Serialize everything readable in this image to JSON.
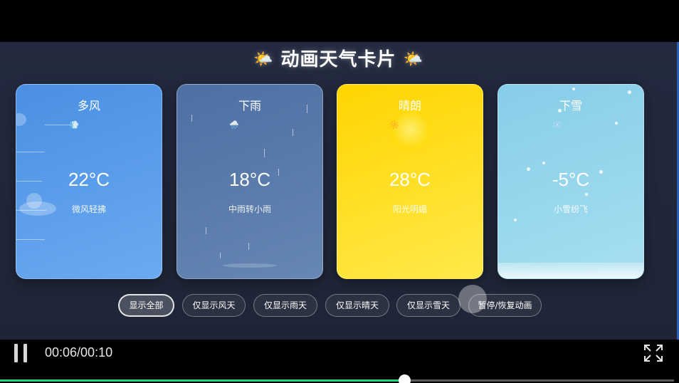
{
  "title": {
    "emoji": "🌤️",
    "text": "动画天气卡片"
  },
  "cards": [
    {
      "name": "多风",
      "temp": "22°C",
      "desc": "微风轻拂",
      "icon": "💨"
    },
    {
      "name": "下雨",
      "temp": "18°C",
      "desc": "中雨转小雨",
      "icon": "🌧️"
    },
    {
      "name": "晴朗",
      "temp": "28°C",
      "desc": "阳光明媚",
      "icon": "☀️"
    },
    {
      "name": "下雪",
      "temp": "-5°C",
      "desc": "小雪纷飞",
      "icon": "❄️"
    }
  ],
  "filters": {
    "show_all": "显示全部",
    "only_wind": "仅显示风天",
    "only_rain": "仅显示雨天",
    "only_sunny": "仅显示晴天",
    "only_snow": "仅显示雪天",
    "toggle_animation": "暂停/恢复动画",
    "active": "显示全部"
  },
  "player": {
    "time": "00:06/00:10",
    "progress": 0.6,
    "progress_color": "#1fd67c"
  },
  "colors": {
    "windy": "#4a8fe3",
    "rain": "#4d6fa3",
    "sunny": "#ffd400",
    "snow": "#86cde9"
  }
}
